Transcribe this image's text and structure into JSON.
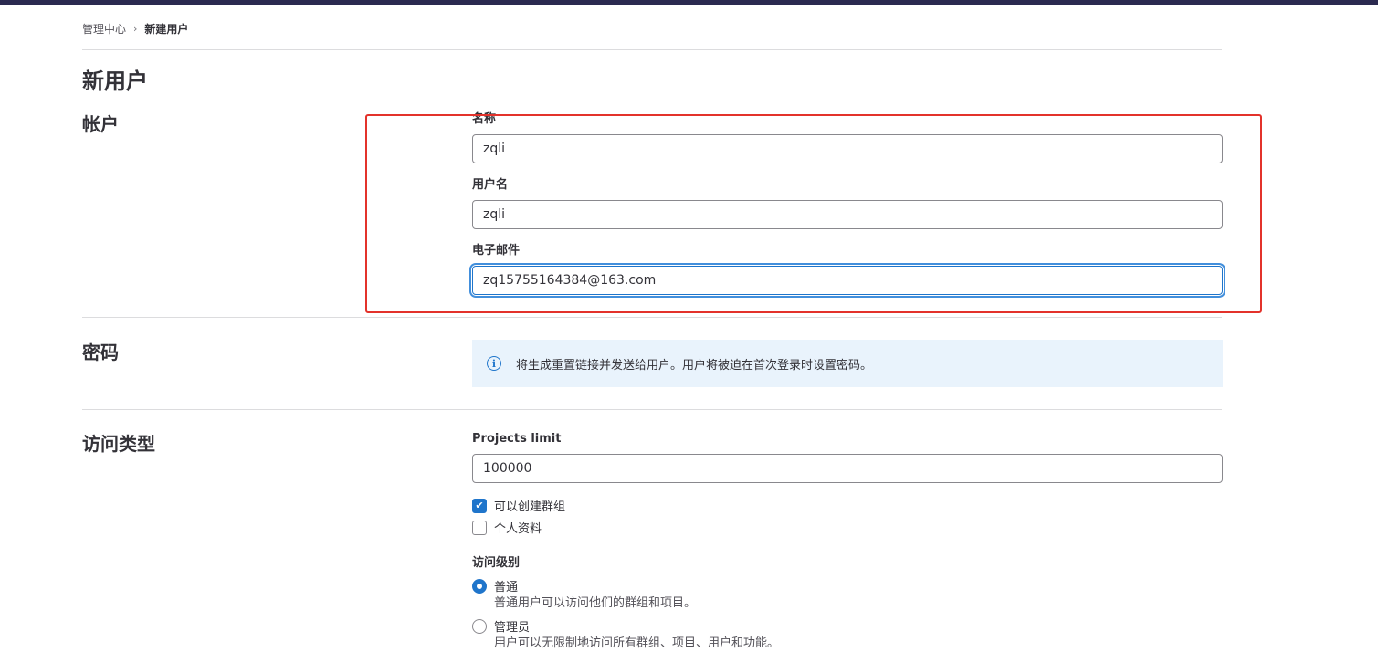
{
  "colors": {
    "topbar": "#2b2a50",
    "accent": "#1f75cb",
    "highlight": "#e3322b",
    "alert_bg": "#e9f3fc"
  },
  "breadcrumb": {
    "parent": "管理中心",
    "separator": "›",
    "current": "新建用户"
  },
  "page_title": "新用户",
  "account": {
    "section_title": "帐户",
    "name_label": "名称",
    "name_value": "zqli",
    "username_label": "用户名",
    "username_value": "zqli",
    "email_label": "电子邮件",
    "email_value": "zq15755164384@163.com"
  },
  "password": {
    "section_title": "密码",
    "info_icon": "i",
    "notice": "将生成重置链接并发送给用户。用户将被迫在首次登录时设置密码。"
  },
  "access": {
    "section_title": "访问类型",
    "projects_limit_label": "Projects limit",
    "projects_limit_value": "100000",
    "can_create_group_label": "可以创建群组",
    "can_create_group_checked": true,
    "private_profile_label": "个人资料",
    "private_profile_checked": false,
    "access_level_label": "访问级别",
    "levels": [
      {
        "label": "普通",
        "description": "普通用户可以访问他们的群组和项目。",
        "selected": true
      },
      {
        "label": "管理员",
        "description": "用户可以无限制地访问所有群组、项目、用户和功能。",
        "selected": false
      }
    ],
    "check_icon": "✔"
  }
}
